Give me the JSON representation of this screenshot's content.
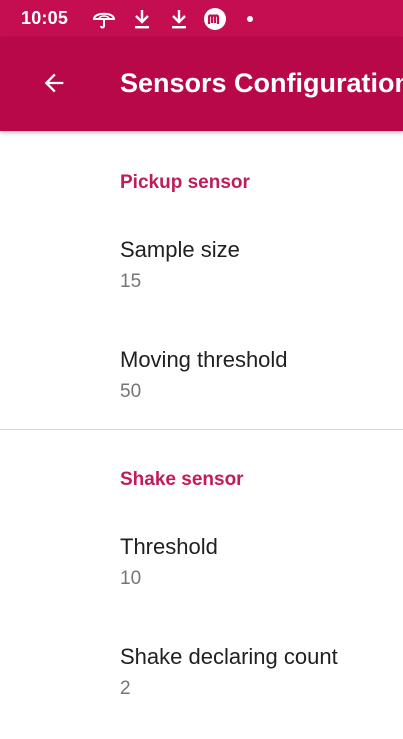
{
  "status_bar": {
    "time": "10:05",
    "icons": [
      "umbrella-icon",
      "download-icon",
      "download-icon",
      "m-badge-icon",
      "dot-icon"
    ]
  },
  "app_bar": {
    "title": "Sensors Configuration",
    "back_icon": "arrow-back-icon"
  },
  "sections": [
    {
      "header": "Pickup sensor",
      "items": [
        {
          "title": "Sample size",
          "summary": "15"
        },
        {
          "title": "Moving threshold",
          "summary": "50"
        }
      ]
    },
    {
      "header": "Shake sensor",
      "items": [
        {
          "title": "Threshold",
          "summary": "10"
        },
        {
          "title": "Shake declaring count",
          "summary": "2"
        }
      ]
    }
  ],
  "colors": {
    "status_bar": "#c40e51",
    "app_bar": "#b8084a",
    "accent": "#c21b5b",
    "primary_text": "#202020",
    "secondary_text": "#757575"
  }
}
